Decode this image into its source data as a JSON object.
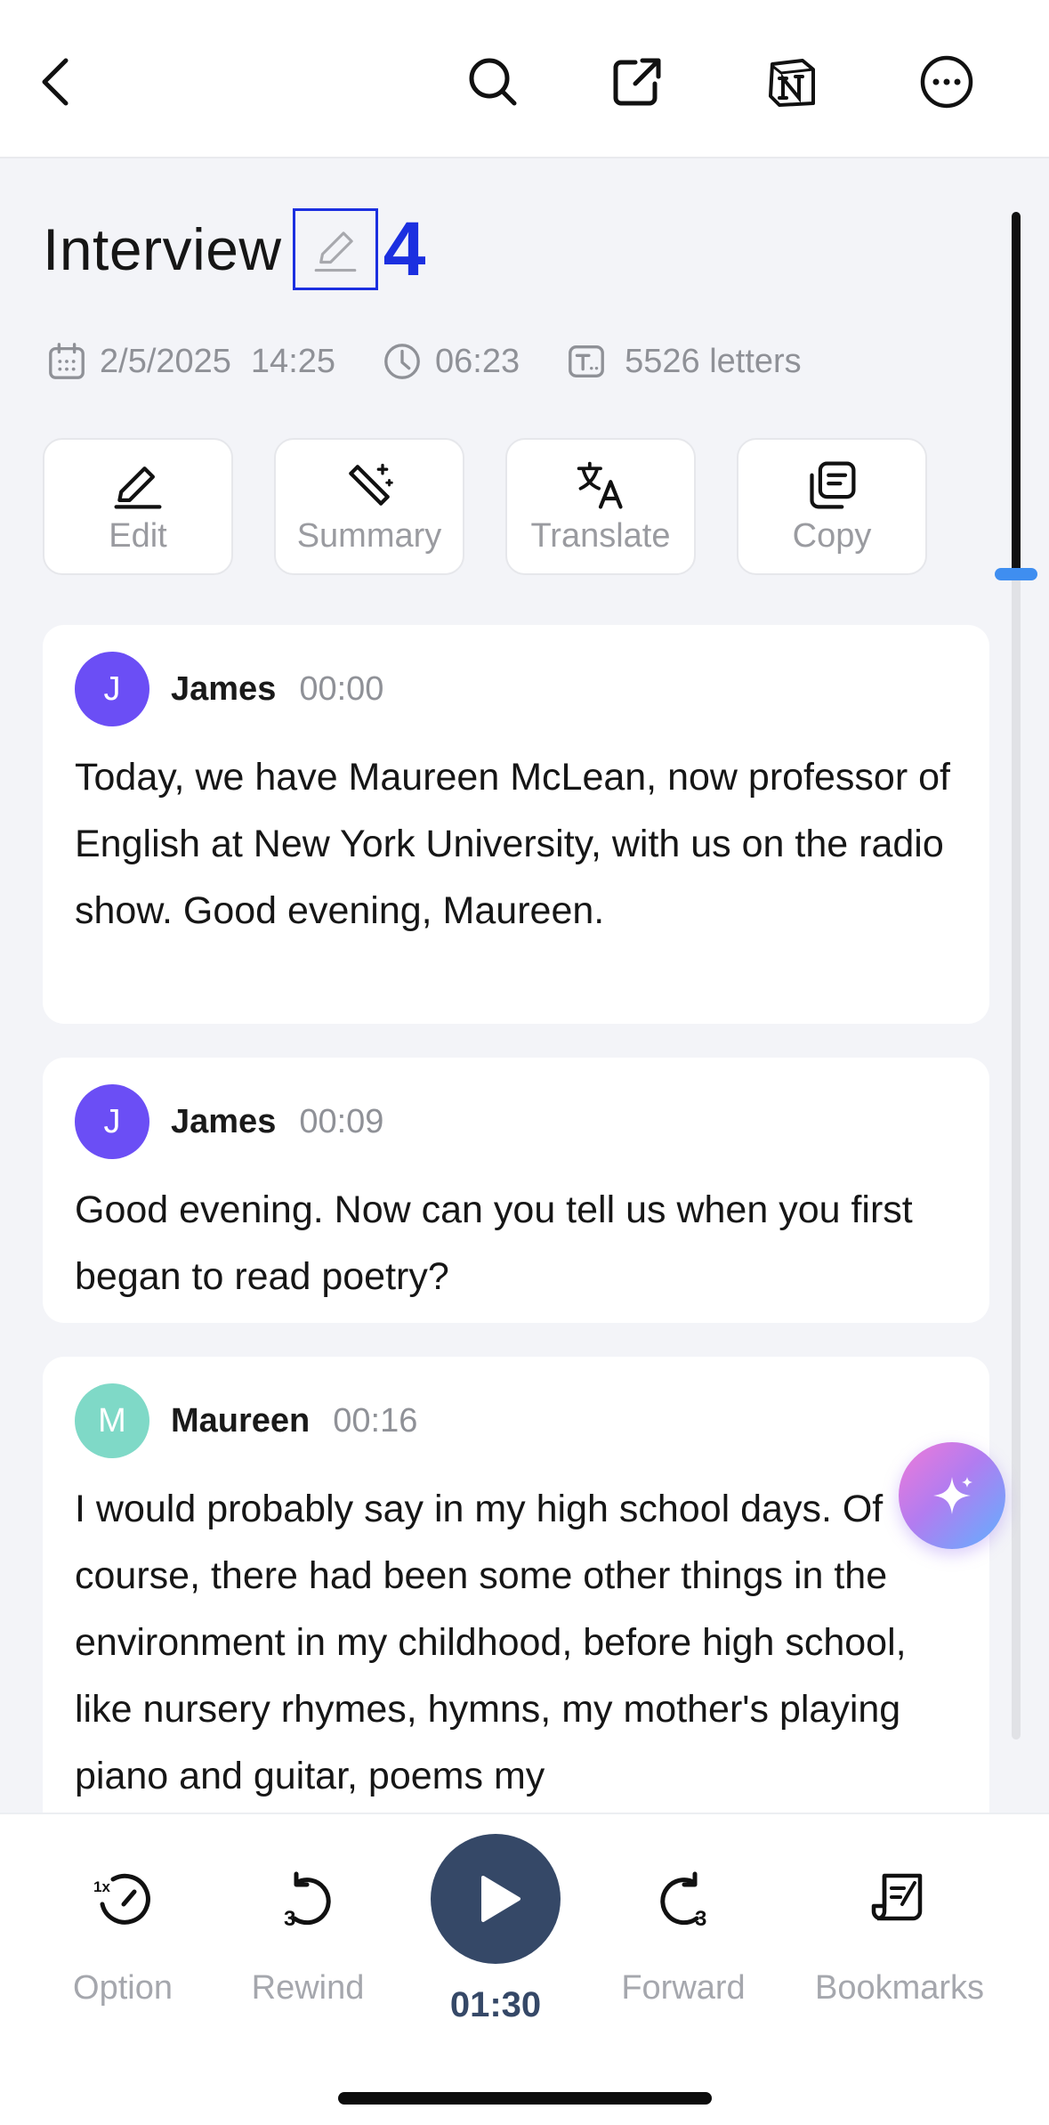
{
  "header": {
    "title": "Interview",
    "badge": "4"
  },
  "meta": {
    "date": "2/5/2025",
    "time": "14:25",
    "duration": "06:23",
    "letters": "5526 letters"
  },
  "actions": [
    {
      "label": "Edit",
      "icon": "pencil-icon"
    },
    {
      "label": "Summary",
      "icon": "magic-wand-icon"
    },
    {
      "label": "Translate",
      "icon": "translate-icon"
    },
    {
      "label": "Copy",
      "icon": "copy-icon"
    }
  ],
  "transcript": [
    {
      "initial": "J",
      "speaker": "James",
      "time": "00:00",
      "color": "#6b4ef5",
      "text": "Today, we have Maureen McLean, now professor of English at New York University, with us on the radio show. Good evening, Maureen."
    },
    {
      "initial": "J",
      "speaker": "James",
      "time": "00:09",
      "color": "#6b4ef5",
      "text": "Good evening. Now can you tell us when you first began to read poetry?"
    },
    {
      "initial": "M",
      "speaker": "Maureen",
      "time": "00:16",
      "color": "#7fd9c7",
      "text": "I would probably say in my high school days. Of course, there had been some other things in the environment in my childhood, before high school, like nursery rhymes, hymns, my mother's playing piano and guitar, poems my"
    }
  ],
  "player": {
    "option": "Option",
    "option_speed": "1x",
    "rewind": "Rewind",
    "rewind_secs": "3",
    "current_time": "01:30",
    "forward": "Forward",
    "forward_secs": "3",
    "bookmarks": "Bookmarks"
  },
  "colors": {
    "accent_blue": "#1b2fe0",
    "player_dark": "#354867",
    "scroll_marker": "#3f8ef0"
  }
}
